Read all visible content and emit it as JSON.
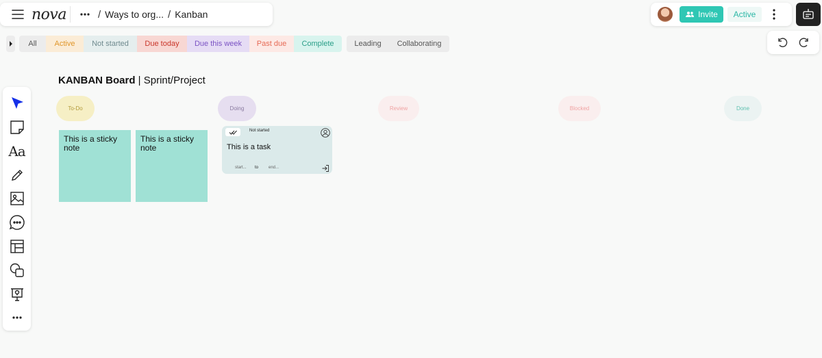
{
  "header": {
    "logo": "nova",
    "breadcrumb": [
      {
        "label": "Ways to org..."
      },
      {
        "label": "Kanban"
      }
    ]
  },
  "top_right": {
    "invite_label": "Invite",
    "status_label": "Active"
  },
  "filters": {
    "status": [
      {
        "label": "All",
        "bg": "#ececec",
        "color": "#555555"
      },
      {
        "label": "Active",
        "bg": "#fbecd6",
        "color": "#e0962a"
      },
      {
        "label": "Not started",
        "bg": "#e5eeee",
        "color": "#6f8a8f"
      },
      {
        "label": "Due today",
        "bg": "#f8d7d3",
        "color": "#c9362a"
      },
      {
        "label": "Due this week",
        "bg": "#e6dcf5",
        "color": "#7b53c4"
      },
      {
        "label": "Past due",
        "bg": "#fde9e5",
        "color": "#e66a55"
      },
      {
        "label": "Complete",
        "bg": "#d8f4ee",
        "color": "#2a9e88"
      }
    ],
    "roles": [
      {
        "label": "Leading"
      },
      {
        "label": "Collaborating"
      }
    ]
  },
  "toolbar": {
    "tools": [
      {
        "name": "select-cursor-icon"
      },
      {
        "name": "sticky-note-icon"
      },
      {
        "name": "text-icon",
        "label": "Aa"
      },
      {
        "name": "pen-icon"
      },
      {
        "name": "image-icon"
      },
      {
        "name": "comment-icon"
      },
      {
        "name": "table-icon"
      },
      {
        "name": "shapes-icon"
      },
      {
        "name": "presentation-icon"
      },
      {
        "name": "more-tools-icon"
      }
    ]
  },
  "board": {
    "title_bold": "KANBAN Board",
    "title_rest": " | Sprint/Project",
    "columns": [
      {
        "label": "To-Do",
        "bg": "#f6efc5",
        "color": "#b39a3a"
      },
      {
        "label": "Doing",
        "bg": "#e6def0",
        "color": "#8a7aa0"
      },
      {
        "label": "Review",
        "bg": "#faeeee",
        "color": "#f0a3a3"
      },
      {
        "label": "Blocked",
        "bg": "#faeeee",
        "color": "#f0a3a3"
      },
      {
        "label": "Done",
        "bg": "#ebf3f2",
        "color": "#5fc0b0"
      }
    ],
    "stickies": [
      {
        "text": "This is a sticky note"
      },
      {
        "text": "This is a sticky note"
      }
    ],
    "task": {
      "status": "Not started",
      "title": "This is a task",
      "start": "start...",
      "to": "to",
      "end": "end..."
    }
  }
}
